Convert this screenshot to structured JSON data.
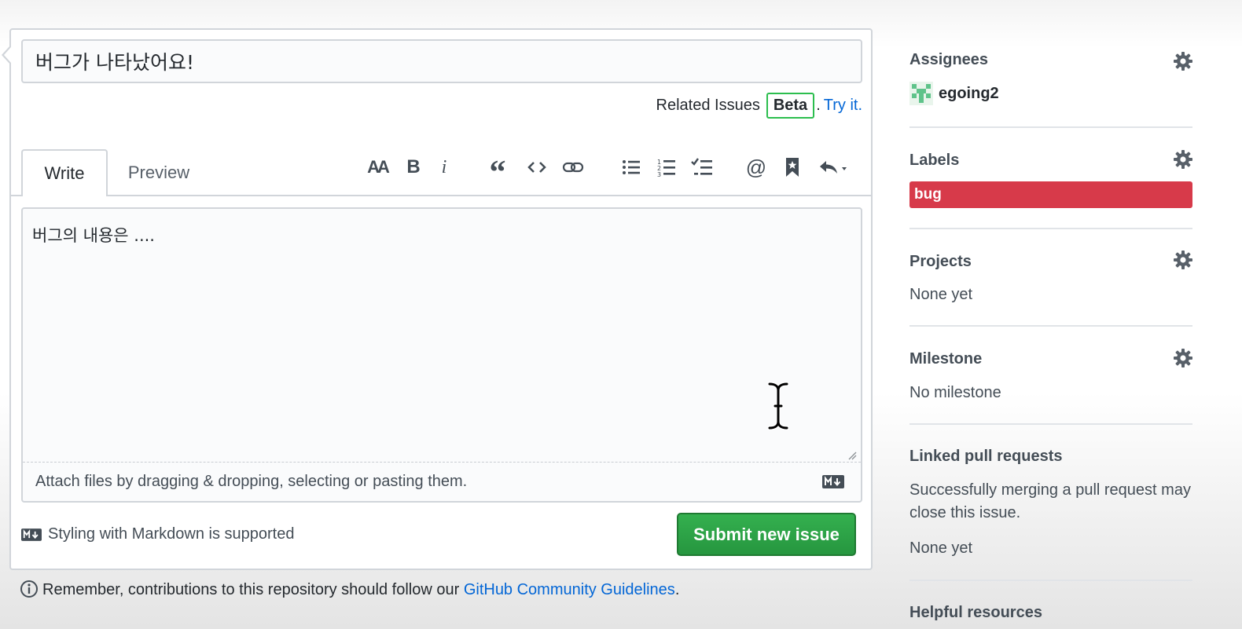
{
  "issue": {
    "title_value": "버그가 나타났어요!",
    "related_issues_label": "Related Issues",
    "beta_badge": "Beta",
    "related_separator": ".",
    "try_it_link": "Try it.",
    "body_value": "버그의 내용은 ....",
    "attach_hint": "Attach files by dragging & dropping, selecting or pasting them.",
    "markdown_note": "Styling with Markdown is supported",
    "submit_label": "Submit new issue"
  },
  "tabs": [
    {
      "label": "Write",
      "active": true
    },
    {
      "label": "Preview",
      "active": false
    }
  ],
  "toolbar": {
    "heading_glyph": "AA",
    "bold_glyph": "B",
    "italic_glyph": "i",
    "quote_glyph": "“",
    "mention_glyph": "@",
    "icons": [
      "text-size-icon",
      "bold-icon",
      "italic-icon",
      "quote-icon",
      "code-icon",
      "link-icon",
      "bulleted-list-icon",
      "numbered-list-icon",
      "task-list-icon",
      "mention-icon",
      "saved-reply-icon",
      "reply-dropdown-icon"
    ]
  },
  "footer": {
    "guidelines_prefix": "Remember, contributions to this repository should follow our ",
    "guidelines_link": "GitHub Community Guidelines",
    "guidelines_suffix": "."
  },
  "sidebar": {
    "assignees": {
      "heading": "Assignees",
      "name": "egoing2"
    },
    "labels": {
      "heading": "Labels",
      "label": "bug",
      "label_color": "#d73a4a"
    },
    "projects": {
      "heading": "Projects",
      "value": "None yet"
    },
    "milestone": {
      "heading": "Milestone",
      "value": "No milestone"
    },
    "linked_prs": {
      "heading": "Linked pull requests",
      "description": "Successfully merging a pull request may close this issue.",
      "value": "None yet"
    },
    "helpful": {
      "heading": "Helpful resources"
    }
  },
  "colors": {
    "accent_link": "#0366d6",
    "submit_green": "#28a745",
    "beta_border": "#2cbe4e",
    "label_bug": "#d73a4a"
  }
}
